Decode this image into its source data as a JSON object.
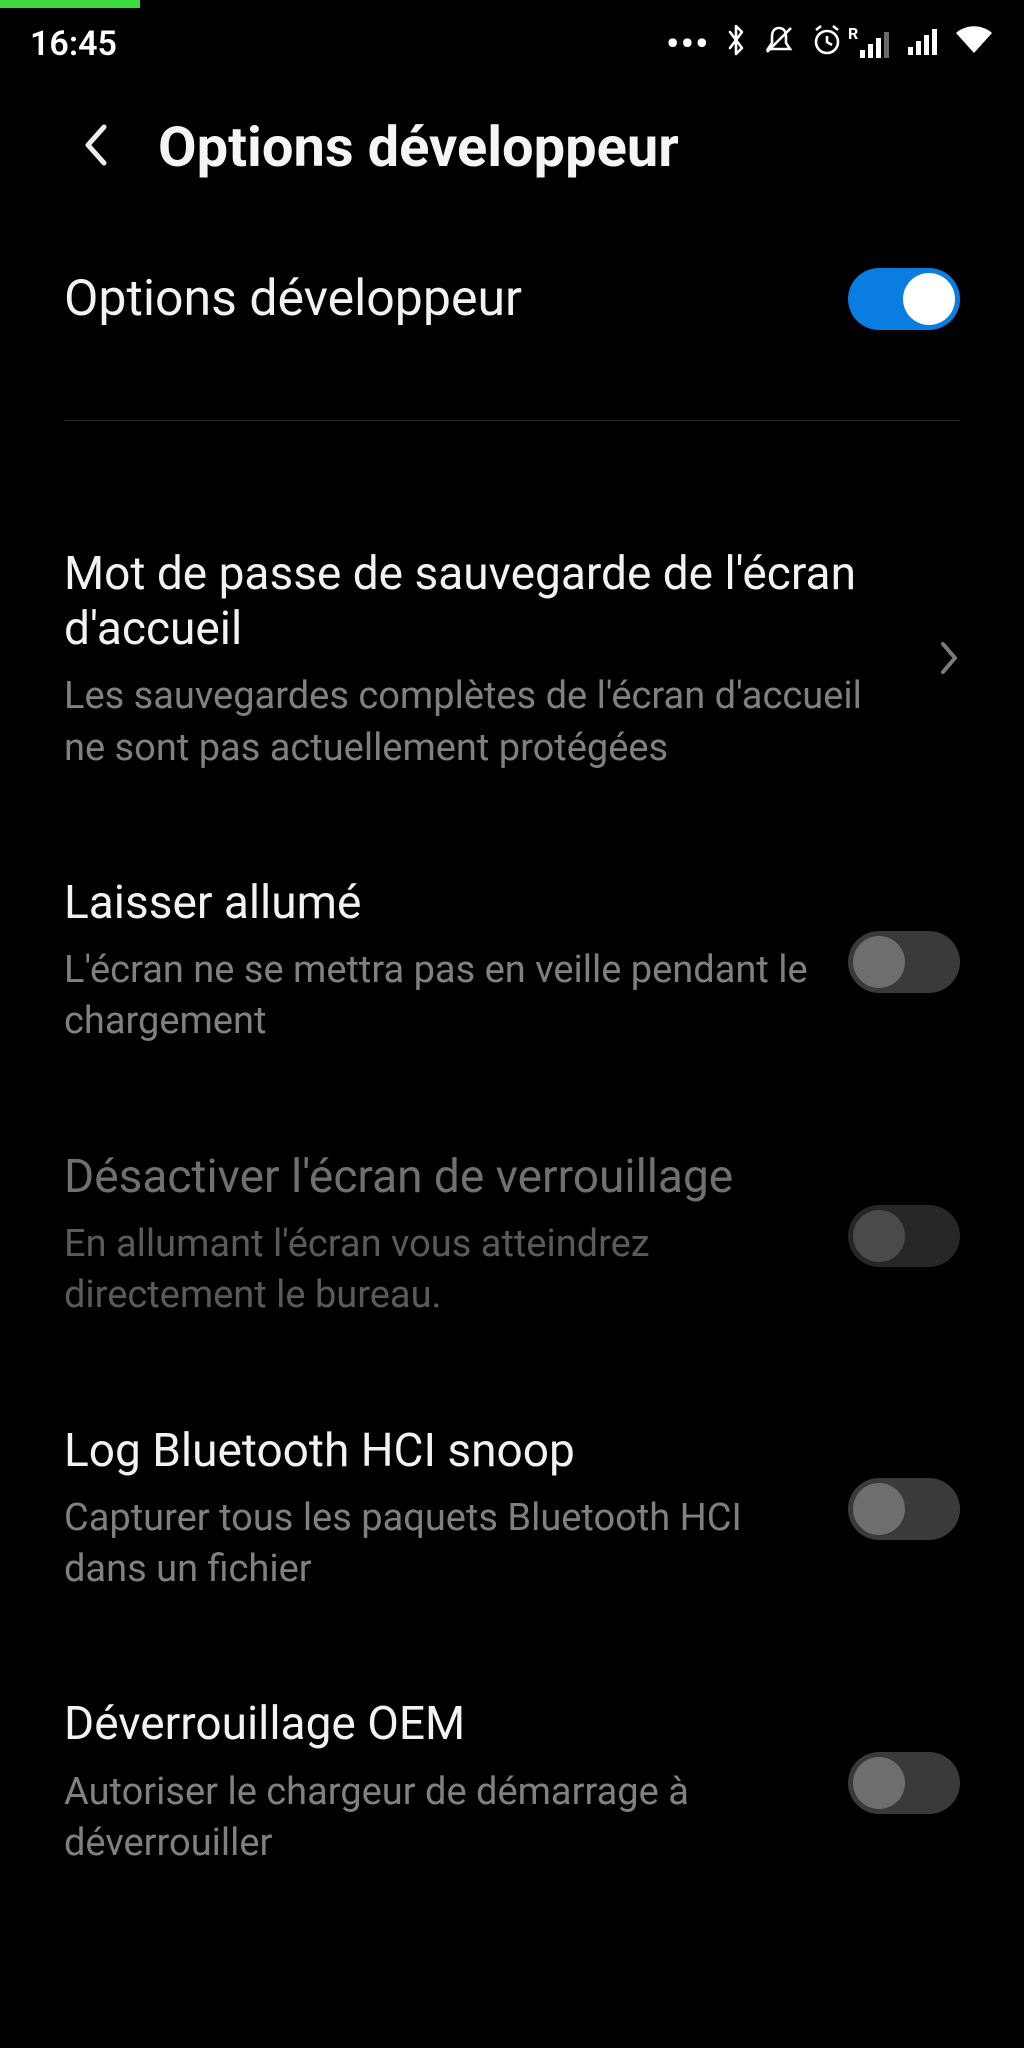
{
  "status": {
    "time": "16:45",
    "roaming_indicator": "R"
  },
  "header": {
    "title": "Options développeur"
  },
  "master": {
    "label": "Options développeur",
    "enabled": true
  },
  "settings": [
    {
      "id": "backup-password",
      "label": "Mot de passe de sauvegarde de l'écran d'accueil",
      "sub": "Les sauvegardes complètes de l'écran d'accueil ne sont pas actuellement protégées",
      "kind": "link"
    },
    {
      "id": "stay-awake",
      "label": "Laisser allumé",
      "sub": "L'écran ne se mettra pas en veille pendant le chargement",
      "kind": "toggle",
      "enabled": false,
      "disabled": false
    },
    {
      "id": "disable-lockscreen",
      "label": "Désactiver l'écran de verrouillage",
      "sub": "En allumant l'écran vous atteindrez directement le bureau.",
      "kind": "toggle",
      "enabled": false,
      "disabled": true
    },
    {
      "id": "bt-hci-snoop",
      "label": "Log Bluetooth HCI snoop",
      "sub": "Capturer tous les paquets Bluetooth HCI dans un fichier",
      "kind": "toggle",
      "enabled": false,
      "disabled": false
    },
    {
      "id": "oem-unlock",
      "label": "Déverrouillage OEM",
      "sub": "Autoriser le chargeur de démarrage à déverrouiller",
      "kind": "toggle",
      "enabled": false,
      "disabled": false
    }
  ]
}
